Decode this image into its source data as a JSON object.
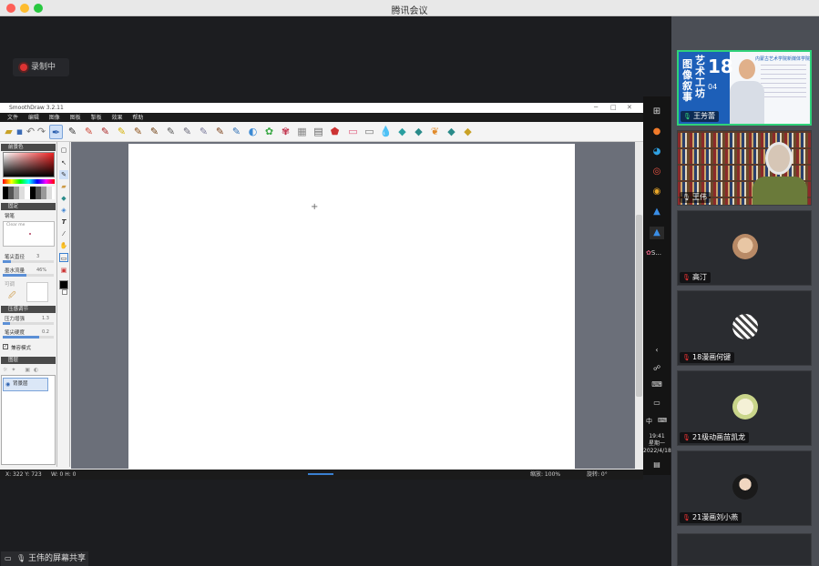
{
  "window": {
    "title": "腾讯会议"
  },
  "recording": {
    "label": "录制中"
  },
  "app": {
    "title": "SmoothDraw 3.2.11",
    "menu": [
      "文件",
      "编辑",
      "图像",
      "图板",
      "掣板",
      "效果",
      "帮助"
    ],
    "panels": {
      "color": "前景色",
      "brush_group": "固定",
      "brush_name": "钢笔",
      "clear_me": "Clear me",
      "brush_size_label": "笔尖直径",
      "brush_size_value": "3",
      "ink_label": "墨水流量",
      "ink_value": "46%",
      "paper_label": "可调",
      "pressure_title": "压感调节",
      "pressure_label": "压力增强",
      "pressure_value": "1.3",
      "tip_label": "笔尖硬度",
      "tip_value": "0.2",
      "smooth_label": "兼容模式",
      "layers_title": "图层",
      "layer_name": "背景层"
    },
    "status": {
      "coords": "X: 322 Y: 723",
      "wh": "W: 0 H: 0",
      "zoom": "缩放: 100%",
      "rotate": "旋转: 0°"
    }
  },
  "taskbar": {
    "time": "19:41",
    "weekday": "星期一",
    "date": "2022/4/18",
    "ime": "中",
    "app_label": "S..."
  },
  "screenshare": {
    "label": "王伟的屏幕共享"
  },
  "participants": [
    {
      "name": "王芳蕾",
      "type": "video"
    },
    {
      "name": "王伟",
      "type": "video"
    },
    {
      "name": "高汀",
      "type": "avatar"
    },
    {
      "name": "18漫画何键",
      "type": "avatar"
    },
    {
      "name": "21级动画苗凯龙",
      "type": "avatar"
    },
    {
      "name": "21漫画刘小燕",
      "type": "avatar"
    }
  ],
  "poster": {
    "vertical_text": "图像叙事",
    "vertical_text2": "艺术工坊",
    "number": "18",
    "sub": "04",
    "header": "内蒙古艺术学院新媒体学院"
  },
  "colors": {
    "accent": "#2fd27a",
    "toolbar_bg": "#1b1b1b"
  }
}
